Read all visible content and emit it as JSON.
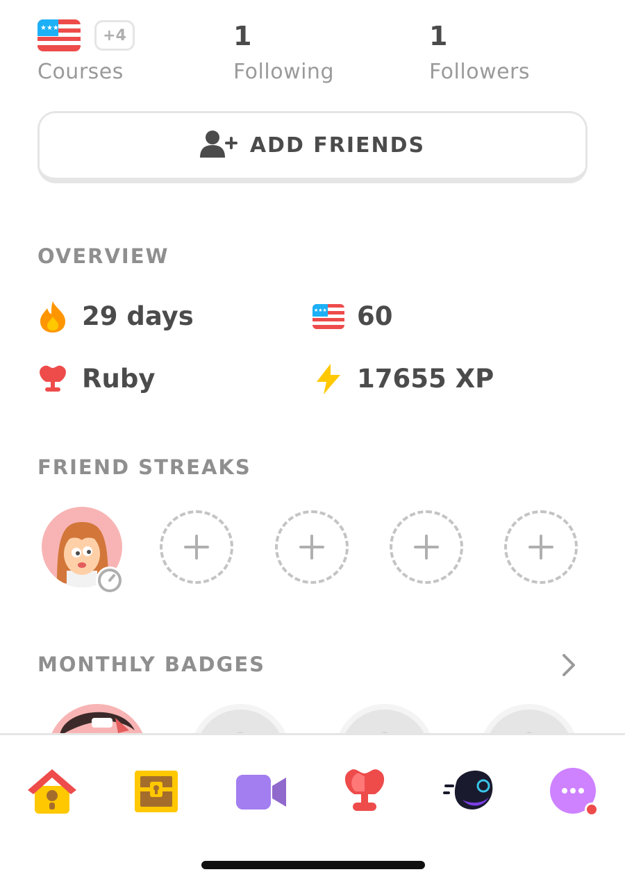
{
  "profile_stats": {
    "courses_label": "Courses",
    "courses_extra": "+4",
    "following_count": "1",
    "following_label": "Following",
    "followers_count": "1",
    "followers_label": "Followers"
  },
  "add_friends": {
    "label": "ADD FRIENDS",
    "icon": "add-person-icon"
  },
  "overview": {
    "title": "OVERVIEW",
    "streak": "29 days",
    "course_value": "60",
    "league": "Ruby",
    "xp": "17655 XP"
  },
  "friend_streaks": {
    "title": "FRIEND STREAKS",
    "empty_slots": 4
  },
  "monthly_badges": {
    "title": "MONTHLY BADGES"
  },
  "tab_bar": {
    "items": [
      "home",
      "treasure-chest",
      "video-call",
      "leagues",
      "explore",
      "more"
    ]
  },
  "colors": {
    "text": "#4b4b4b",
    "muted": "#9a9a9a",
    "flame": "#ff9600",
    "ruby": "#ee4b4b",
    "xp": "#ffc800",
    "more": "#ce82ff"
  }
}
